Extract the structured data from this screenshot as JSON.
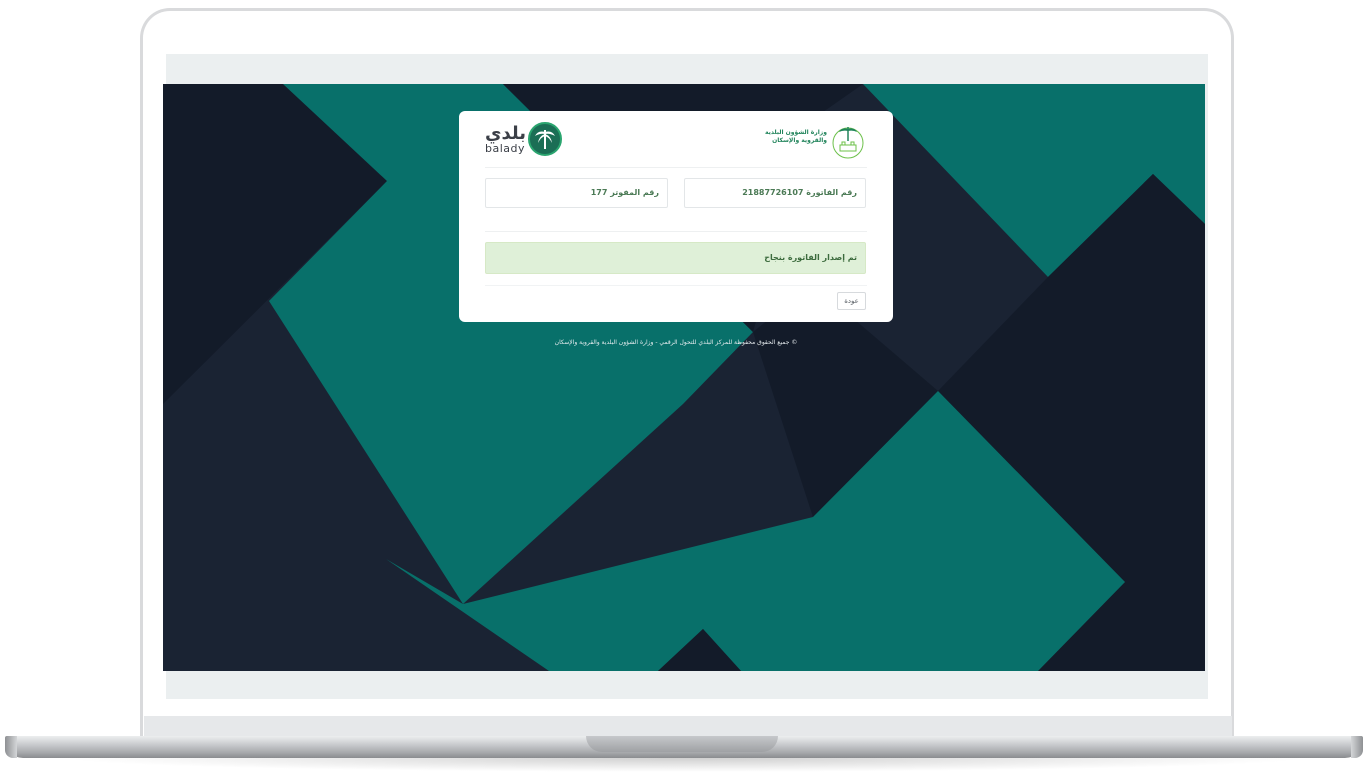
{
  "brand": {
    "balady_arabic": "بلدي",
    "balady_english": "balady",
    "ministry_name_line1": "وزارة الشؤون البلدية",
    "ministry_name_line2": "والقروية والإسكان"
  },
  "invoice": {
    "invoice_field": "رقم الفاتورة 21887726107",
    "collector_field": "رقم المفوتر 177"
  },
  "alert": {
    "message": "تم إصدار الفاتورة بنجاح"
  },
  "actions": {
    "back_label": "عودة"
  },
  "footer": {
    "copyright": "© جميع الحقوق محفوظة للمركز البلدي للتحول الرقمي - وزارة الشؤون البلدية والقروية والإسكان"
  },
  "colors": {
    "background_dark": "#1a2333",
    "background_teal": "#08706a",
    "success_bg": "#dff0d8",
    "brand_green": "#21845b"
  }
}
